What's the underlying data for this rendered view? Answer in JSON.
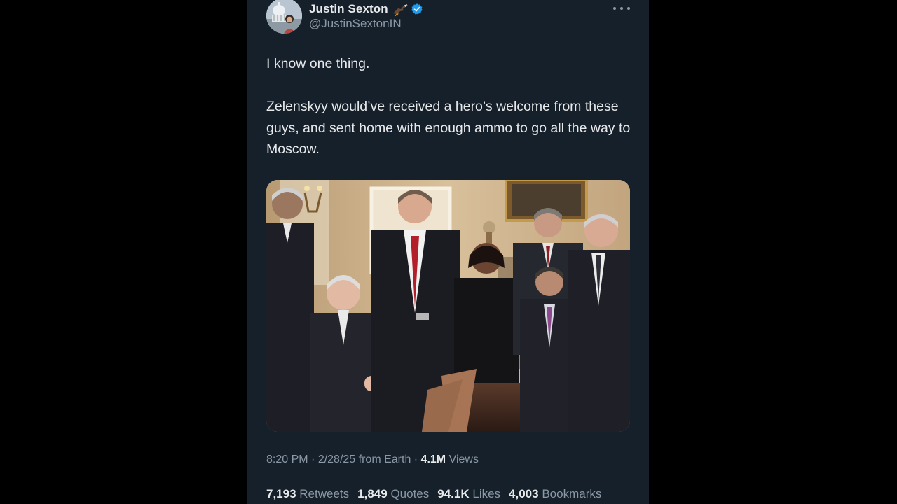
{
  "tweet": {
    "author": {
      "name": "Justin Sexton",
      "handle": "@JustinSextonIN",
      "name_emoji_icon": "eagle-icon",
      "verified_icon": "verified-badge-icon",
      "avatar_icon": "capitol-avatar-icon"
    },
    "more_icon": "more-options-icon",
    "text": [
      "I know one thing.",
      "Zelenskyy would’ve received a hero’s welcome from these guys, and sent home with enough ammo to go all the way to Moscow."
    ],
    "media": {
      "kind": "photo",
      "icon": "group-photo"
    },
    "meta": {
      "time": "8:20 PM",
      "sep1": " · ",
      "date": "2/28/25",
      "source": " from Earth",
      "sep2": " · ",
      "views_count": "4.1M",
      "views_label": " Views"
    },
    "stats": [
      {
        "count": "7,193",
        "label": "Retweets"
      },
      {
        "count": "1,849",
        "label": "Quotes"
      },
      {
        "count": "94.1K",
        "label": "Likes"
      },
      {
        "count": "4,003",
        "label": "Bookmarks"
      }
    ]
  },
  "colors": {
    "page_background": "#000000",
    "panel_background": "#15202b",
    "text_primary": "#e7e9ea",
    "text_secondary": "#8b98a5",
    "verified_blue": "#1d9bf0",
    "divider": "#38444d"
  }
}
